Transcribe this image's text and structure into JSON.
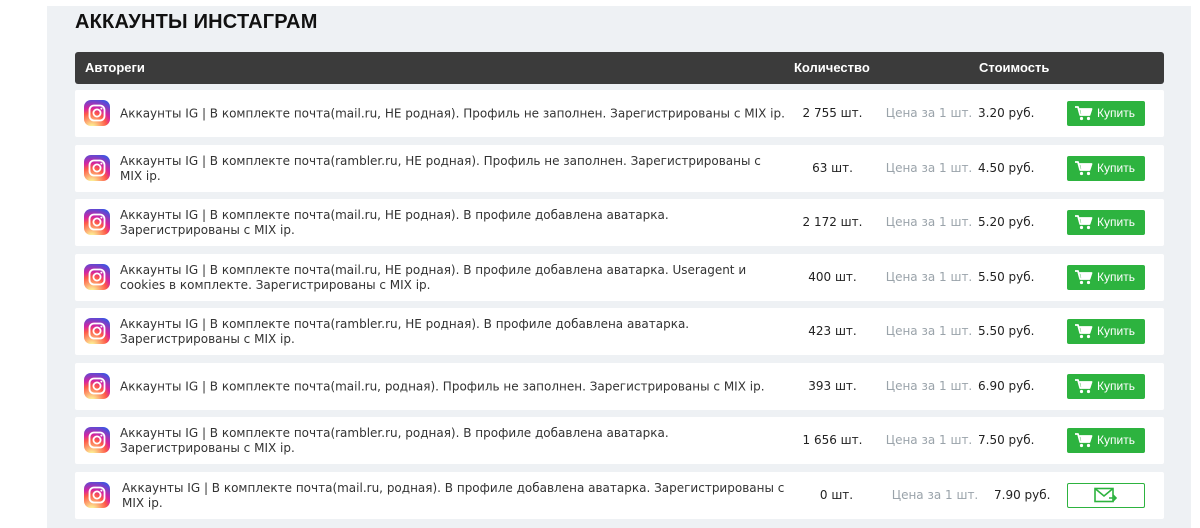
{
  "page": {
    "title": "АККАУНТЫ ИНСТАГРАМ"
  },
  "table": {
    "headers": {
      "autoreg": "Автореги",
      "quantity": "Количество",
      "cost": "Стоимость"
    },
    "rows": [
      {
        "desc": "Аккаунты IG | В комплекте почта(mail.ru, НЕ родная). Профиль не заполнен. Зарегистрированы с MIX ip.",
        "qty": "2 755 шт.",
        "unit": "Цена за 1 шт.",
        "price": "3.20 руб.",
        "action": "Купить"
      },
      {
        "desc": "Аккаунты IG | В комплекте почта(rambler.ru, НЕ родная). Профиль не заполнен. Зарегистрированы с MIX ip.",
        "qty": "63 шт.",
        "unit": "Цена за 1 шт.",
        "price": "4.50 руб.",
        "action": "Купить"
      },
      {
        "desc": "Аккаунты IG | В комплекте почта(mail.ru, НЕ родная). В профиле добавлена аватарка. Зарегистрированы с MIX ip.",
        "qty": "2 172 шт.",
        "unit": "Цена за 1 шт.",
        "price": "5.20 руб.",
        "action": "Купить"
      },
      {
        "desc": "Аккаунты IG | В комплекте почта(mail.ru, НЕ родная). В профиле добавлена аватарка. Useragent и cookies в комплекте. Зарегистрированы с MIX ip.",
        "qty": "400 шт.",
        "unit": "Цена за 1 шт.",
        "price": "5.50 руб.",
        "action": "Купить"
      },
      {
        "desc": "Аккаунты IG | В комплекте почта(rambler.ru, НЕ родная). В профиле добавлена аватарка. Зарегистрированы с MIX ip.",
        "qty": "423 шт.",
        "unit": "Цена за 1 шт.",
        "price": "5.50 руб.",
        "action": "Купить"
      },
      {
        "desc": "Аккаунты IG | В комплекте почта(mail.ru, родная). Профиль не заполнен. Зарегистрированы с MIX ip.",
        "qty": "393 шт.",
        "unit": "Цена за 1 шт.",
        "price": "6.90 руб.",
        "action": "Купить"
      },
      {
        "desc": "Аккаунты IG | В комплекте почта(rambler.ru, родная). В профиле добавлена аватарка. Зарегистрированы с MIX ip.",
        "qty": "1 656 шт.",
        "unit": "Цена за 1 шт.",
        "price": "7.50 руб.",
        "action": "Купить"
      },
      {
        "desc": "Аккаунты IG | В комплекте почта(mail.ru, родная). В профиле добавлена аватарка. Зарегистрированы с MIX ip.",
        "qty": "0 шт.",
        "unit": "Цена за 1 шт.",
        "price": "7.90 руб.",
        "action_icon": "mail-icon"
      }
    ]
  },
  "icons": {
    "row_icon": "instagram-icon",
    "buy_icon": "cart-icon"
  },
  "colors": {
    "header_bg": "#3b3b3b",
    "buy_green": "#2db33f",
    "panel_bg": "#eef1f4"
  }
}
